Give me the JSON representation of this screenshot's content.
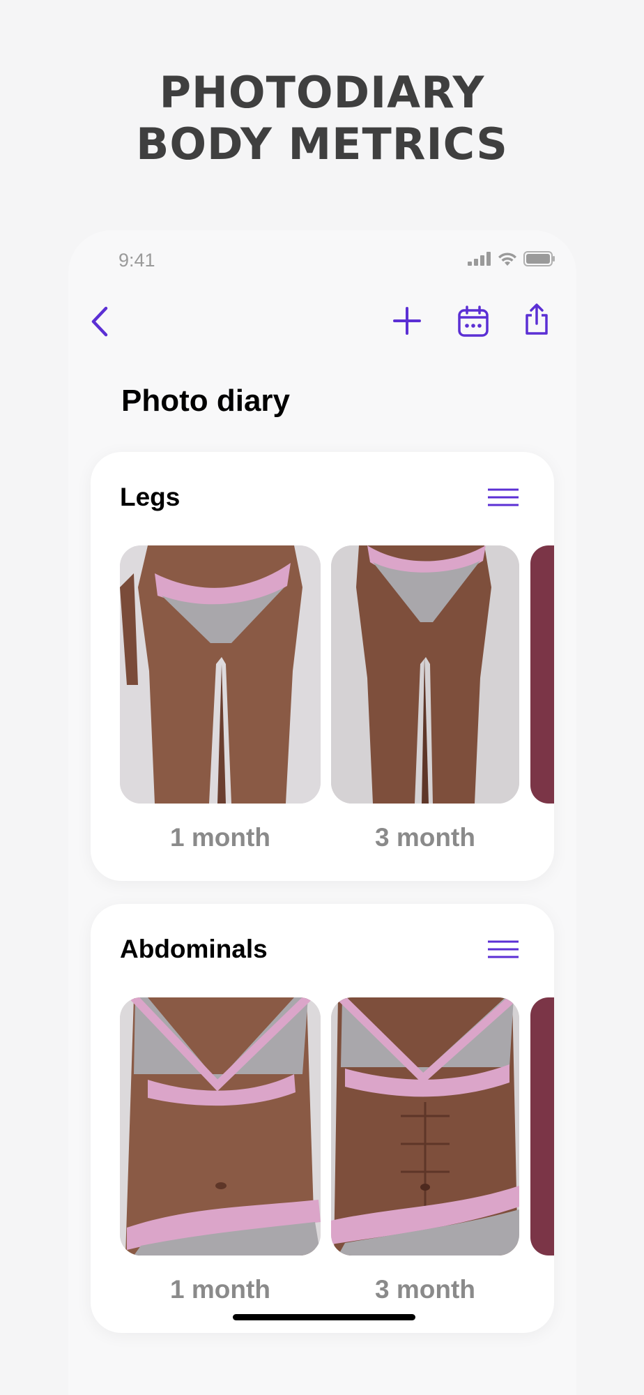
{
  "headline": {
    "line1": "PHOTODIARY",
    "line2": "BODY METRICS"
  },
  "status_bar": {
    "time": "9:41"
  },
  "toolbar": {
    "back_icon": "chevron-left-icon",
    "add_icon": "plus-icon",
    "calendar_icon": "calendar-icon",
    "share_icon": "share-icon"
  },
  "colors": {
    "accent": "#5b2fd4",
    "background": "#f5f5f6",
    "card": "#ffffff",
    "label_gray": "#8a8a8a"
  },
  "page": {
    "title": "Photo diary"
  },
  "sections": [
    {
      "title": "Legs",
      "menu_icon": "hamburger-menu-icon",
      "photos": [
        {
          "label": "1 month"
        },
        {
          "label": "3 month"
        },
        {
          "label": ""
        }
      ]
    },
    {
      "title": "Abdominals",
      "menu_icon": "hamburger-menu-icon",
      "photos": [
        {
          "label": "1 month"
        },
        {
          "label": "3 month"
        },
        {
          "label": ""
        }
      ]
    }
  ]
}
